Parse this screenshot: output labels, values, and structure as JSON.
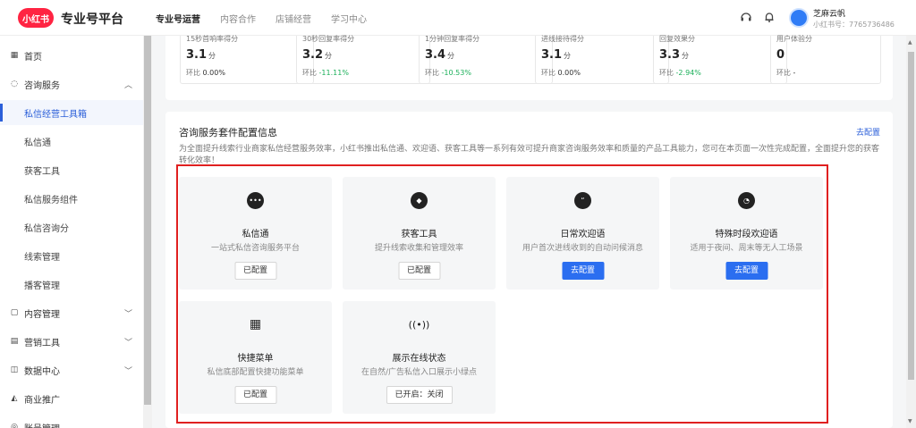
{
  "header": {
    "logo_text": "小红书",
    "brand": "专业号平台",
    "nav": [
      "专业号运营",
      "内容合作",
      "店铺经营",
      "学习中心"
    ],
    "user": {
      "name": "芝麻云帆",
      "id": "小红书号：7765736486"
    },
    "icons": [
      "headset-icon",
      "bell-icon"
    ]
  },
  "sidebar": {
    "items": [
      {
        "label": "首页",
        "icon": "grid-icon",
        "type": "top"
      },
      {
        "label": "咨询服务",
        "icon": "chat-icon",
        "type": "top",
        "expanded": true
      },
      {
        "label": "私信经营工具箱",
        "type": "sub",
        "active": true
      },
      {
        "label": "私信通",
        "type": "sub"
      },
      {
        "label": "获客工具",
        "type": "sub"
      },
      {
        "label": "私信服务组件",
        "type": "sub"
      },
      {
        "label": "私信咨询分",
        "type": "sub"
      },
      {
        "label": "线索管理",
        "type": "sub"
      },
      {
        "label": "播客管理",
        "type": "sub"
      },
      {
        "label": "内容管理",
        "icon": "content-icon",
        "type": "top"
      },
      {
        "label": "营销工具",
        "icon": "marketing-icon",
        "type": "top"
      },
      {
        "label": "数据中心",
        "icon": "data-icon",
        "type": "top"
      },
      {
        "label": "商业推广",
        "icon": "promo-icon",
        "type": "top"
      },
      {
        "label": "账号管理",
        "icon": "account-icon",
        "type": "top"
      }
    ]
  },
  "stats": [
    {
      "label": "15秒首响率得分",
      "value": "3.1",
      "unit": "分",
      "change_label": "环比",
      "change": "0.00%",
      "trend": "flat"
    },
    {
      "label": "30秒回复率得分",
      "value": "3.2",
      "unit": "分",
      "change_label": "环比",
      "change": "-11.11%",
      "trend": "down"
    },
    {
      "label": "1分钟回复率得分",
      "value": "3.4",
      "unit": "分",
      "change_label": "环比",
      "change": "-10.53%",
      "trend": "down"
    },
    {
      "label": "进线接待得分",
      "value": "3.1",
      "unit": "分",
      "change_label": "环比",
      "change": "0.00%",
      "trend": "flat"
    },
    {
      "label": "回复效果分",
      "value": "3.3",
      "unit": "分",
      "change_label": "环比",
      "change": "-2.94%",
      "trend": "down"
    },
    {
      "label": "用户体验分",
      "value": "0",
      "unit": "",
      "change_label": "环比",
      "change": "-",
      "trend": "flat"
    }
  ],
  "config": {
    "title": "咨询服务套件配置信息",
    "link": "去配置",
    "description": "为全面提升线索行业商家私信经营服务效率，小红书推出私信通、欢迎语、获客工具等一系列有效可提升商家咨询服务效率和质量的产品工具能力，您可在本页面一次性完成配置，全面提升您的获客转化效率！",
    "tools": [
      {
        "name": "私信通",
        "desc": "一站式私信咨询服务平台",
        "button": "已配置",
        "primary": false,
        "icon": "message-icon",
        "glyph": "•••"
      },
      {
        "name": "获客工具",
        "desc": "提升线索收集和管理效率",
        "button": "已配置",
        "primary": false,
        "icon": "handshake-icon",
        "glyph": "◆"
      },
      {
        "name": "日常欢迎语",
        "desc": "用户首次进线收到的自动问候消息",
        "button": "去配置",
        "primary": true,
        "icon": "quote-icon",
        "glyph": "“"
      },
      {
        "name": "特殊时段欢迎语",
        "desc": "适用于夜间、周末等无人工场景",
        "button": "去配置",
        "primary": true,
        "icon": "clock-icon",
        "glyph": "◔"
      },
      {
        "name": "快捷菜单",
        "desc": "私信底部配置快捷功能菜单",
        "button": "已配置",
        "primary": false,
        "icon": "menu-grid-icon",
        "glyph": "▦"
      },
      {
        "name": "展示在线状态",
        "desc": "在自然/广告私信入口展示小绿点",
        "button": "已开启：关闭",
        "primary": false,
        "icon": "broadcast-icon",
        "glyph": "((•))"
      }
    ]
  }
}
